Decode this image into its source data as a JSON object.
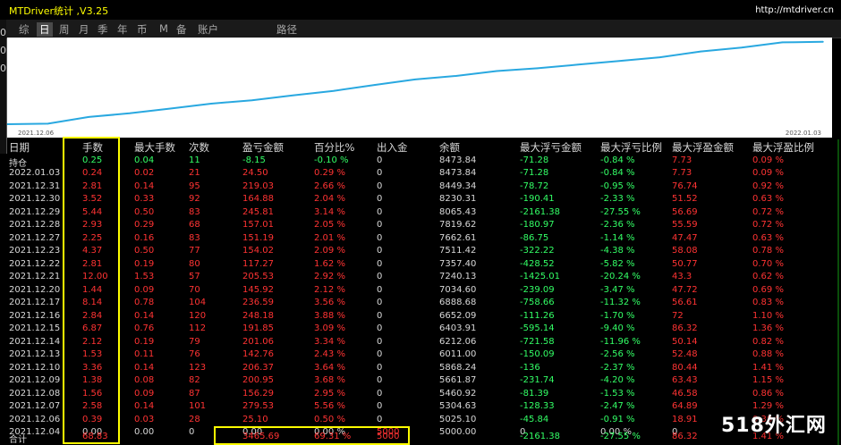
{
  "window": {
    "title": "MTDriver统计 ,V3.25",
    "url": "http://mtdriver.cn"
  },
  "left_edge_glyphs": [
    "0",
    "0",
    "0"
  ],
  "tabs": [
    {
      "label": "综",
      "active": false
    },
    {
      "label": "日",
      "active": true
    },
    {
      "label": "周",
      "active": false
    },
    {
      "label": "月",
      "active": false
    },
    {
      "label": "季",
      "active": false
    },
    {
      "label": "年",
      "active": false
    },
    {
      "label": "币",
      "active": false
    },
    {
      "label": "M",
      "active": false
    },
    {
      "label": "备",
      "active": false
    },
    {
      "label": "账户",
      "active": false
    },
    {
      "label": "路径",
      "active": false
    }
  ],
  "chart_data": {
    "type": "line",
    "x_start_label": "2021.12.06",
    "x_end_label": "2022.01.03",
    "x": [
      "2021.12.04",
      "2021.12.06",
      "2021.12.07",
      "2021.12.08",
      "2021.12.09",
      "2021.12.10",
      "2021.12.13",
      "2021.12.14",
      "2021.12.15",
      "2021.12.16",
      "2021.12.17",
      "2021.12.20",
      "2021.12.21",
      "2021.12.22",
      "2021.12.23",
      "2021.12.27",
      "2021.12.28",
      "2021.12.29",
      "2021.12.30",
      "2021.12.31",
      "2022.01.03"
    ],
    "values": [
      5000.0,
      5025.1,
      5304.63,
      5460.92,
      5661.87,
      5868.24,
      6011.0,
      6212.06,
      6403.91,
      6652.09,
      6888.68,
      7034.6,
      7240.13,
      7357.4,
      7511.42,
      7662.61,
      7819.62,
      8065.43,
      8230.31,
      8449.34,
      8473.84
    ],
    "line_color": "#29a8e0",
    "background": "#ffffff"
  },
  "table": {
    "headers": [
      "日期",
      "手数",
      "最大手数",
      "次数",
      "盈亏金额",
      "百分比%",
      "出入金",
      "余额",
      "最大浮亏金额",
      "最大浮亏比例",
      "最大浮盈金额",
      "最大浮盈比例"
    ],
    "holding": [
      "持仓",
      "0.25",
      "0.04",
      "11",
      "-8.15",
      "-0.10 %",
      "0",
      "8473.84",
      "-71.28",
      "-0.84 %",
      "7.73",
      "0.09 %"
    ],
    "rows": [
      [
        "2022.01.03",
        "0.24",
        "0.02",
        "21",
        "24.50",
        "0.29 %",
        "0",
        "8473.84",
        "-71.28",
        "-0.84 %",
        "7.73",
        "0.09 %"
      ],
      [
        "2021.12.31",
        "2.81",
        "0.14",
        "95",
        "219.03",
        "2.66 %",
        "0",
        "8449.34",
        "-78.72",
        "-0.95 %",
        "76.74",
        "0.92 %"
      ],
      [
        "2021.12.30",
        "3.52",
        "0.33",
        "92",
        "164.88",
        "2.04 %",
        "0",
        "8230.31",
        "-190.41",
        "-2.33 %",
        "51.52",
        "0.63 %"
      ],
      [
        "2021.12.29",
        "5.44",
        "0.50",
        "83",
        "245.81",
        "3.14 %",
        "0",
        "8065.43",
        "-2161.38",
        "-27.55 %",
        "56.69",
        "0.72 %"
      ],
      [
        "2021.12.28",
        "2.93",
        "0.29",
        "68",
        "157.01",
        "2.05 %",
        "0",
        "7819.62",
        "-180.97",
        "-2.36 %",
        "55.59",
        "0.72 %"
      ],
      [
        "2021.12.27",
        "2.25",
        "0.16",
        "83",
        "151.19",
        "2.01 %",
        "0",
        "7662.61",
        "-86.75",
        "-1.14 %",
        "47.47",
        "0.63 %"
      ],
      [
        "2021.12.23",
        "4.37",
        "0.50",
        "77",
        "154.02",
        "2.09 %",
        "0",
        "7511.42",
        "-322.22",
        "-4.38 %",
        "58.08",
        "0.78 %"
      ],
      [
        "2021.12.22",
        "2.81",
        "0.19",
        "80",
        "117.27",
        "1.62 %",
        "0",
        "7357.40",
        "-428.52",
        "-5.82 %",
        "50.77",
        "0.70 %"
      ],
      [
        "2021.12.21",
        "12.00",
        "1.53",
        "57",
        "205.53",
        "2.92 %",
        "0",
        "7240.13",
        "-1425.01",
        "-20.24 %",
        "43.3",
        "0.62 %"
      ],
      [
        "2021.12.20",
        "1.44",
        "0.09",
        "70",
        "145.92",
        "2.12 %",
        "0",
        "7034.60",
        "-239.09",
        "-3.47 %",
        "47.72",
        "0.69 %"
      ],
      [
        "2021.12.17",
        "8.14",
        "0.78",
        "104",
        "236.59",
        "3.56 %",
        "0",
        "6888.68",
        "-758.66",
        "-11.32 %",
        "56.61",
        "0.83 %"
      ],
      [
        "2021.12.16",
        "2.84",
        "0.14",
        "120",
        "248.18",
        "3.88 %",
        "0",
        "6652.09",
        "-111.26",
        "-1.70 %",
        "72",
        "1.10 %"
      ],
      [
        "2021.12.15",
        "6.87",
        "0.76",
        "112",
        "191.85",
        "3.09 %",
        "0",
        "6403.91",
        "-595.14",
        "-9.40 %",
        "86.32",
        "1.36 %"
      ],
      [
        "2021.12.14",
        "2.12",
        "0.19",
        "79",
        "201.06",
        "3.34 %",
        "0",
        "6212.06",
        "-721.58",
        "-11.96 %",
        "50.14",
        "0.82 %"
      ],
      [
        "2021.12.13",
        "1.53",
        "0.11",
        "76",
        "142.76",
        "2.43 %",
        "0",
        "6011.00",
        "-150.09",
        "-2.56 %",
        "52.48",
        "0.88 %"
      ],
      [
        "2021.12.10",
        "3.36",
        "0.14",
        "123",
        "206.37",
        "3.64 %",
        "0",
        "5868.24",
        "-136",
        "-2.37 %",
        "80.44",
        "1.41 %"
      ],
      [
        "2021.12.09",
        "1.38",
        "0.08",
        "82",
        "200.95",
        "3.68 %",
        "0",
        "5661.87",
        "-231.74",
        "-4.20 %",
        "63.43",
        "1.15 %"
      ],
      [
        "2021.12.08",
        "1.56",
        "0.09",
        "87",
        "156.29",
        "2.95 %",
        "0",
        "5460.92",
        "-81.39",
        "-1.53 %",
        "46.58",
        "0.86 %"
      ],
      [
        "2021.12.07",
        "2.58",
        "0.14",
        "101",
        "279.53",
        "5.56 %",
        "0",
        "5304.63",
        "-128.33",
        "-2.47 %",
        "64.89",
        "1.29 %"
      ],
      [
        "2021.12.06",
        "0.39",
        "0.03",
        "28",
        "25.10",
        "0.50 %",
        "0",
        "5025.10",
        "-45.84",
        "-0.91 %",
        "18.91",
        "0.38 %"
      ],
      [
        "2021.12.04",
        "0.00",
        "0.00",
        "0",
        "0.00",
        "0.00 %",
        "5000",
        "5000.00",
        "0",
        "0.00 %",
        "0",
        ""
      ]
    ],
    "total": [
      "合计",
      "68.83",
      "",
      "",
      "3465.69",
      "69.31 %",
      "5000",
      "",
      "-2161.38",
      "-27.55 %",
      "86.32",
      "1.41 %"
    ]
  },
  "watermark": "518外汇网",
  "colors": {
    "positive": "#ff3333",
    "negative": "#33ff66",
    "highlight": "#ffff00",
    "title": "#ffff00"
  }
}
